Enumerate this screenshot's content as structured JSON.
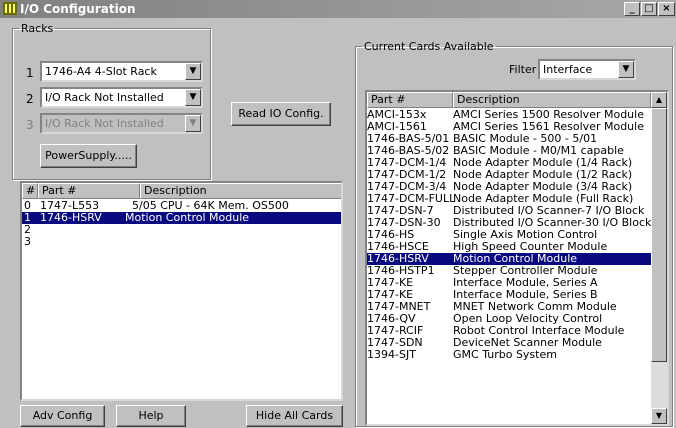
{
  "window": {
    "title": "I/O Configuration"
  },
  "racks": {
    "legend": "Racks",
    "rows": [
      {
        "num": "1",
        "value": "1746-A4  4-Slot Rack"
      },
      {
        "num": "2",
        "value": "I/O Rack Not Installed"
      },
      {
        "num": "3",
        "value": "I/O Rack Not Installed"
      }
    ],
    "power_supply_label": "PowerSupply.....",
    "read_io_label": "Read IO Config."
  },
  "slots": {
    "headers": [
      "#",
      "Part #",
      "Description"
    ],
    "rows": [
      {
        "num": "0",
        "part": "1747-L553",
        "desc": "5/05 CPU - 64K Mem. OS500"
      },
      {
        "num": "1",
        "part": "1746-HSRV",
        "desc": "Motion Control Module"
      },
      {
        "num": "2",
        "part": "",
        "desc": ""
      },
      {
        "num": "3",
        "part": "",
        "desc": ""
      }
    ]
  },
  "bottom_buttons": {
    "adv_config": "Adv Config",
    "help": "Help",
    "hide_all_cards": "Hide All Cards"
  },
  "cards": {
    "legend": "Current Cards Available",
    "filter_label": "Filter",
    "filter_value": "Interface",
    "headers": [
      "Part #",
      "Description"
    ],
    "rows": [
      {
        "part": "AMCI-153x",
        "desc": "AMCI Series 1500 Resolver Module"
      },
      {
        "part": "AMCI-1561",
        "desc": "AMCI Series 1561 Resolver Module"
      },
      {
        "part": "1746-BAS-5/01",
        "desc": "BASIC Module - 500 - 5/01"
      },
      {
        "part": "1746-BAS-5/02",
        "desc": "BASIC Module - M0/M1 capable"
      },
      {
        "part": "1747-DCM-1/4",
        "desc": "Node Adapter Module (1/4 Rack)"
      },
      {
        "part": "1747-DCM-1/2",
        "desc": "Node Adapter Module (1/2 Rack)"
      },
      {
        "part": "1747-DCM-3/4",
        "desc": "Node Adapter Module (3/4 Rack)"
      },
      {
        "part": "1747-DCM-FULL",
        "desc": "Node Adapter Module (Full Rack)"
      },
      {
        "part": "1747-DSN-7",
        "desc": "Distributed I/O Scanner-7 I/O Block"
      },
      {
        "part": "1747-DSN-30",
        "desc": "Distributed I/O Scanner-30 I/O Block"
      },
      {
        "part": "1746-HS",
        "desc": "Single Axis Motion Control"
      },
      {
        "part": "1746-HSCE",
        "desc": "High Speed Counter Module"
      },
      {
        "part": "1746-HSRV",
        "desc": "Motion Control Module"
      },
      {
        "part": "1746-HSTP1",
        "desc": "Stepper Controller Module"
      },
      {
        "part": "1747-KE",
        "desc": "Interface Module, Series A"
      },
      {
        "part": "1747-KE",
        "desc": "Interface Module, Series B"
      },
      {
        "part": "1747-MNET",
        "desc": "MNET Network Comm Module"
      },
      {
        "part": "1746-QV",
        "desc": "Open Loop Velocity Control"
      },
      {
        "part": "1747-RCIF",
        "desc": "Robot Control Interface Module"
      },
      {
        "part": "1747-SDN",
        "desc": "DeviceNet Scanner Module"
      },
      {
        "part": "1394-SJT",
        "desc": "GMC Turbo System"
      }
    ]
  },
  "colors": {
    "selection": "#0a0a80",
    "face": "#c0c0c0"
  }
}
